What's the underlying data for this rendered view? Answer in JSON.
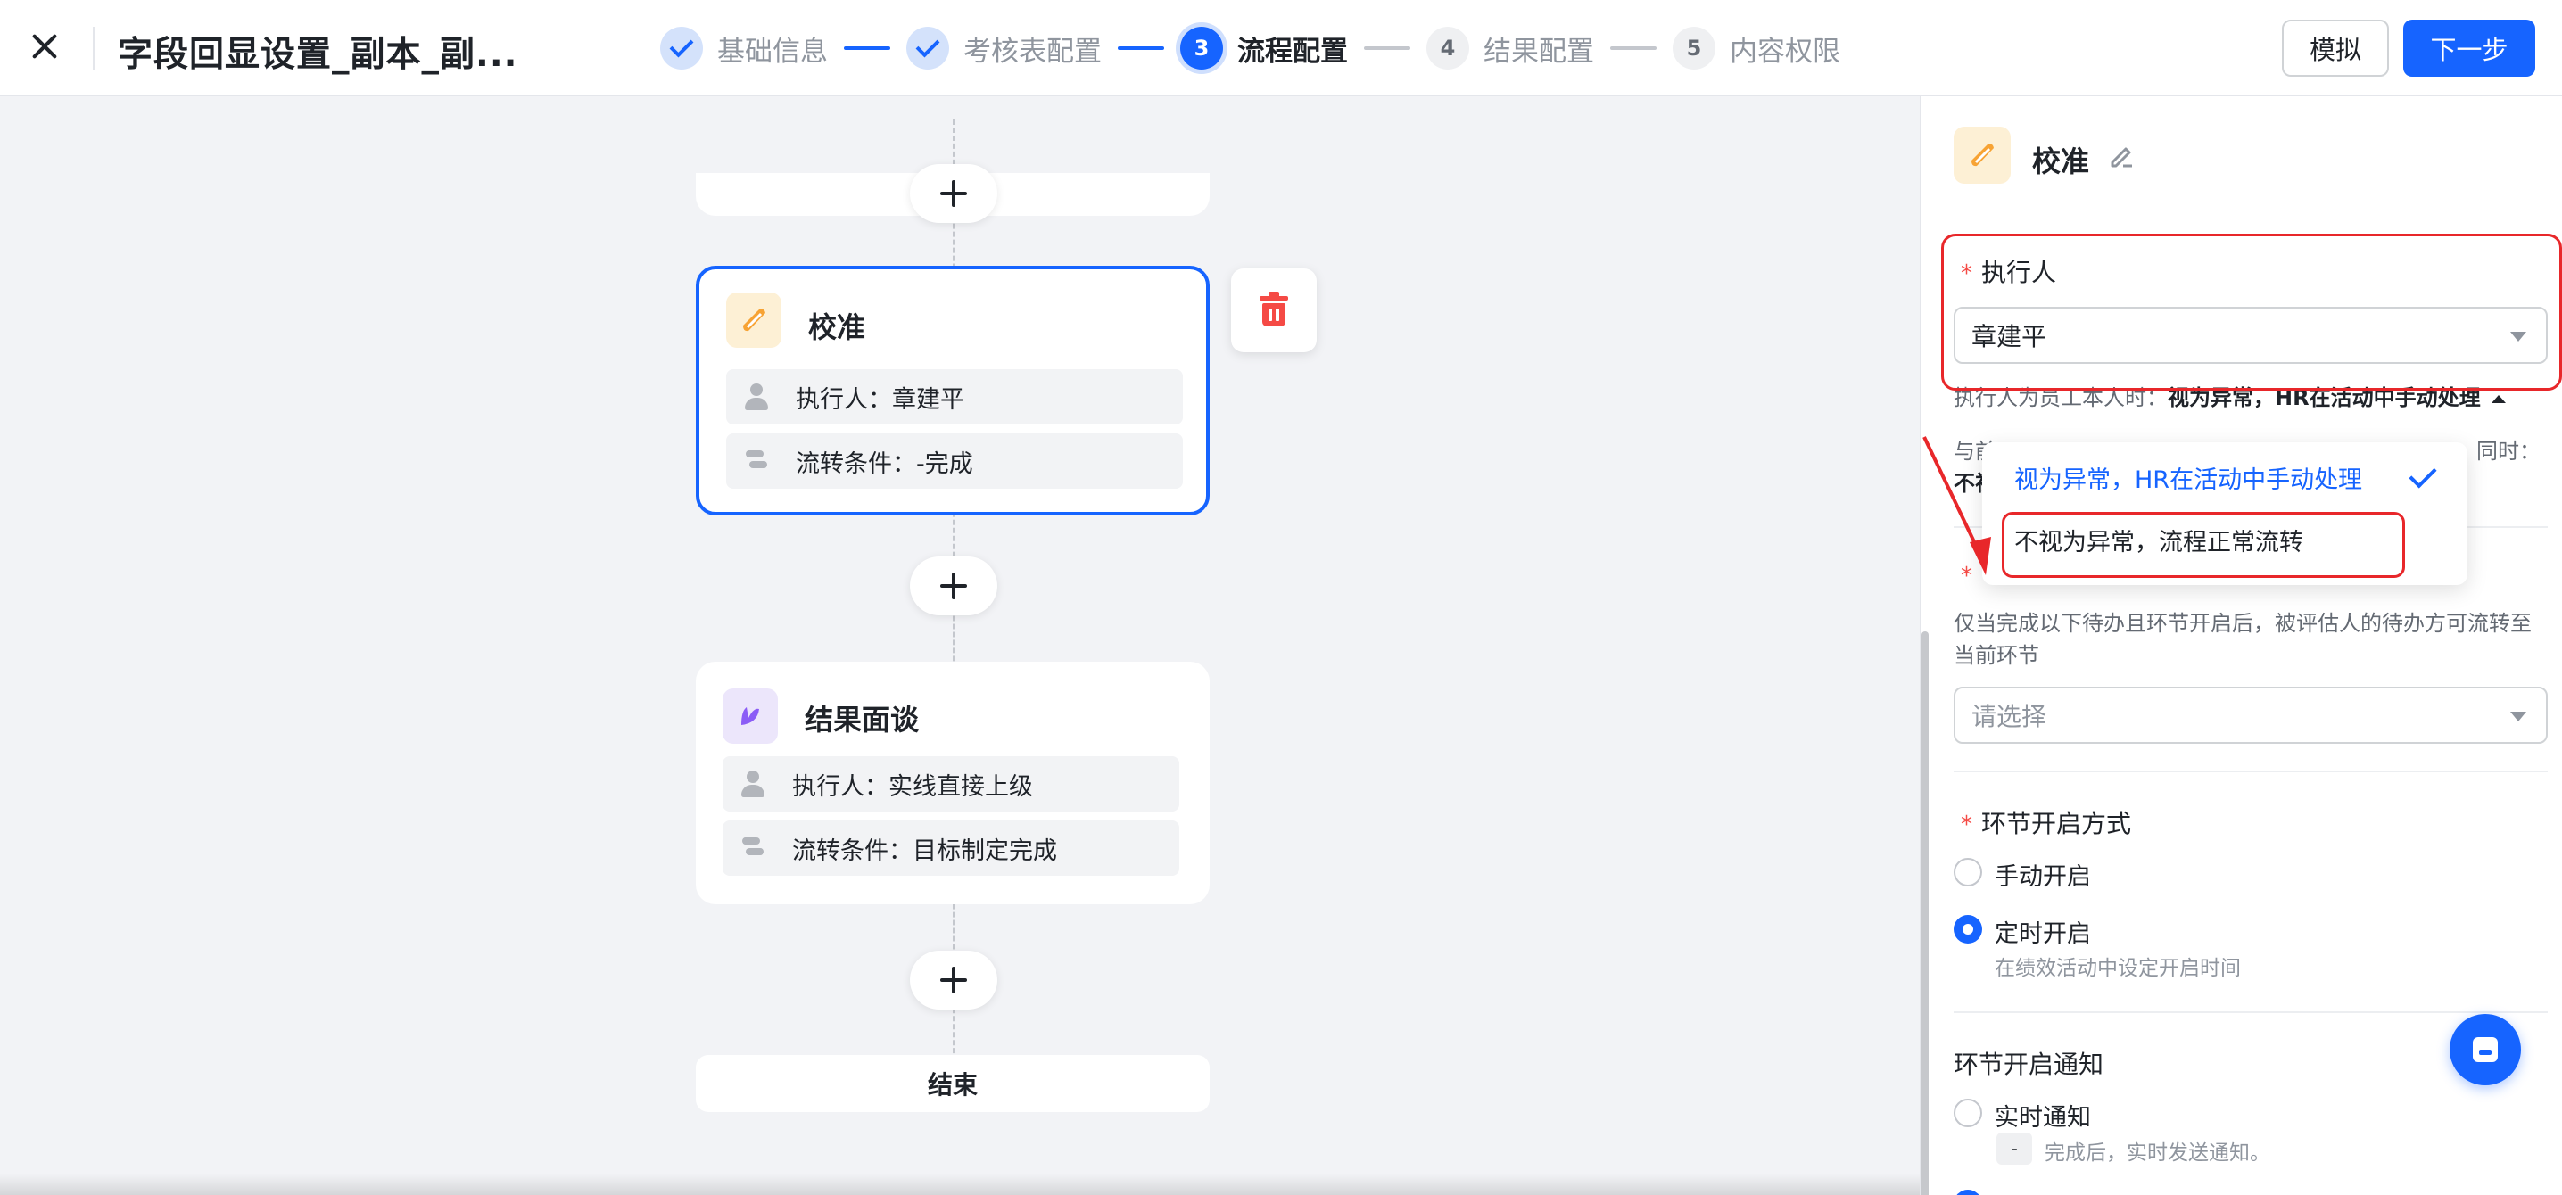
{
  "header": {
    "title": "字段回显设置_副本_副...",
    "simulate_label": "模拟",
    "next_label": "下一步"
  },
  "steps": [
    {
      "label": "基础信息",
      "state": "done",
      "number": ""
    },
    {
      "label": "考核表配置",
      "state": "done",
      "number": ""
    },
    {
      "label": "流程配置",
      "state": "active",
      "number": "3"
    },
    {
      "label": "结果配置",
      "state": "todo",
      "number": "4"
    },
    {
      "label": "内容权限",
      "state": "todo",
      "number": "5"
    }
  ],
  "flow": {
    "calibration": {
      "name": "校准",
      "executor": "执行人：章建平",
      "condition": "流转条件：-完成"
    },
    "interview": {
      "name": "结果面谈",
      "executor": "执行人：实线直接上级",
      "condition": "流转条件：目标制定完成"
    },
    "end_label": "结束"
  },
  "panel": {
    "title": "校准",
    "executor_label": "执行人",
    "executor_value": "章建平",
    "self_hint_prefix": "执行人为员工本人时：",
    "self_hint_value": "视为异常，HR在活动中手动处理",
    "overlap_hint_left": "与前",
    "overlap_hint_right": "同时：",
    "overlap_hint_left2": "不视",
    "prereq_desc_1": "仅当完成以下待办且环节开启后，被评估人的待办方可流转至",
    "prereq_desc_2": "当前环节",
    "prereq_placeholder": "请选择",
    "open_mode_label": "环节开启方式",
    "open_manual": "手动开启",
    "open_scheduled": "定时开启",
    "open_scheduled_sub": "在绩效活动中设定开启时间",
    "notify_label": "环节开启通知",
    "notify_realtime": "实时通知",
    "notify_dash": "-",
    "notify_sub": "完成后，实时发送通知。"
  },
  "dropdown": {
    "options": [
      "视为异常，HR在活动中手动处理",
      "不视为异常，流程正常流转"
    ],
    "selected": "视为异常，HR在活动中手动处理"
  },
  "colors": {
    "accent": "#1664ff",
    "danger": "#f54a45",
    "annotation_red": "#e8272a"
  }
}
